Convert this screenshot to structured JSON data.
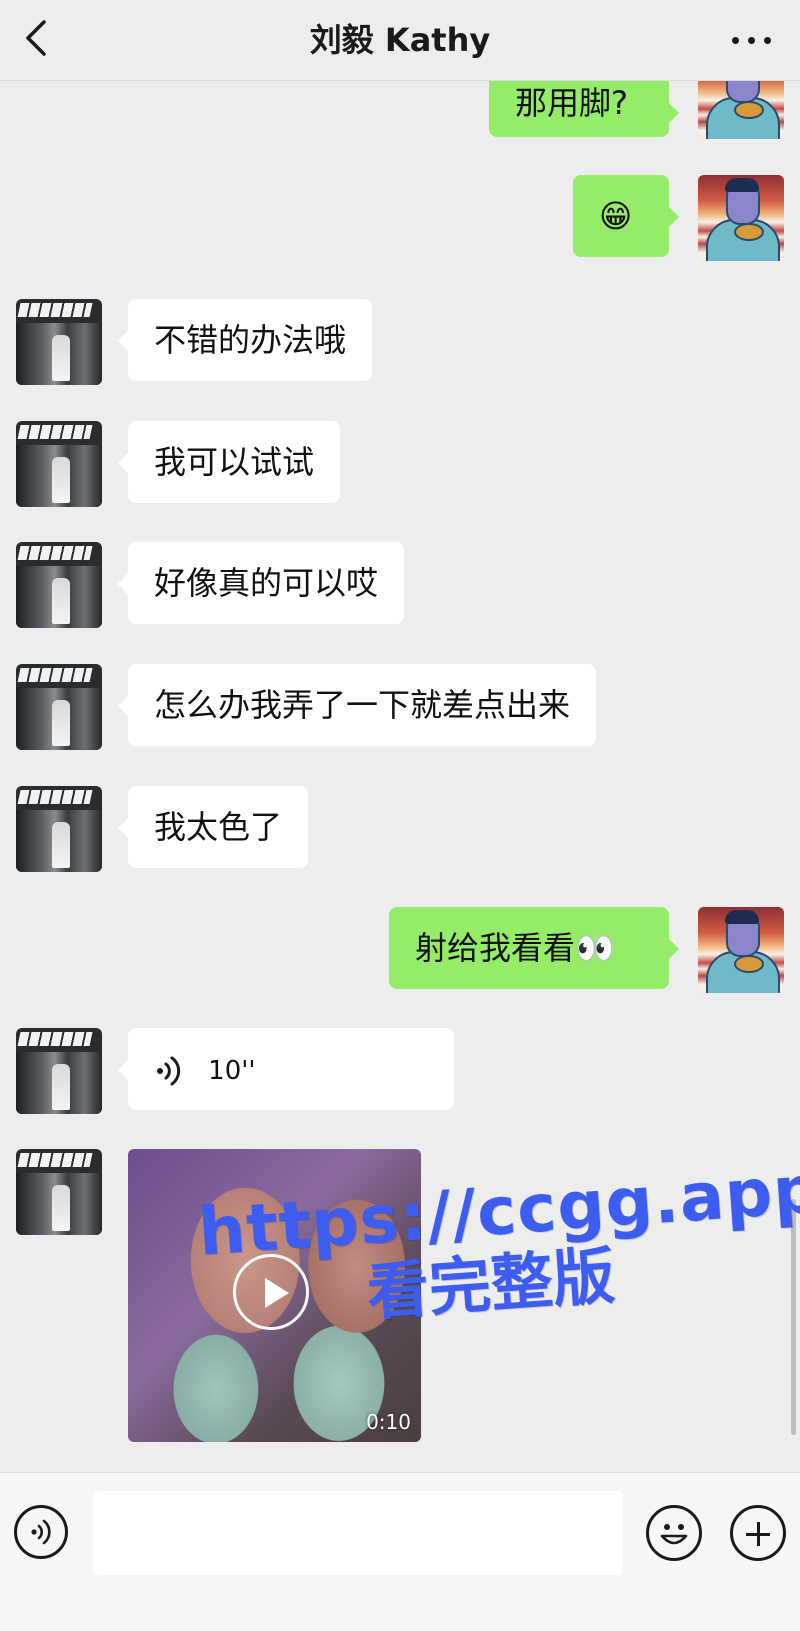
{
  "header": {
    "title": "刘毅 Kathy",
    "back_icon": "chevron-left-icon",
    "more_icon": "more-dots-icon"
  },
  "messages": [
    {
      "side": "out",
      "type": "text",
      "text": "那用脚?"
    },
    {
      "side": "out",
      "type": "emoji",
      "text": "😁"
    },
    {
      "side": "in",
      "type": "text",
      "text": "不错的办法哦"
    },
    {
      "side": "in",
      "type": "text",
      "text": "我可以试试"
    },
    {
      "side": "in",
      "type": "text",
      "text": "好像真的可以哎"
    },
    {
      "side": "in",
      "type": "text",
      "text": "怎么办我弄了一下就差点出来"
    },
    {
      "side": "in",
      "type": "text",
      "text": "我太色了"
    },
    {
      "side": "out",
      "type": "text",
      "text": "射给我看看👀"
    },
    {
      "side": "in",
      "type": "voice",
      "duration": "10''"
    },
    {
      "side": "in",
      "type": "video",
      "duration": "0:10"
    }
  ],
  "watermark": {
    "line1": "https://ccgg.app",
    "line2": "看完整版",
    "color": "#3d5cf0"
  },
  "input_bar": {
    "voice_icon": "voice-icon",
    "emoji_icon": "emoji-icon",
    "plus_icon": "plus-icon",
    "placeholder": ""
  },
  "colors": {
    "background": "#ededed",
    "outgoing_bubble": "#95ec69",
    "incoming_bubble": "#ffffff"
  }
}
